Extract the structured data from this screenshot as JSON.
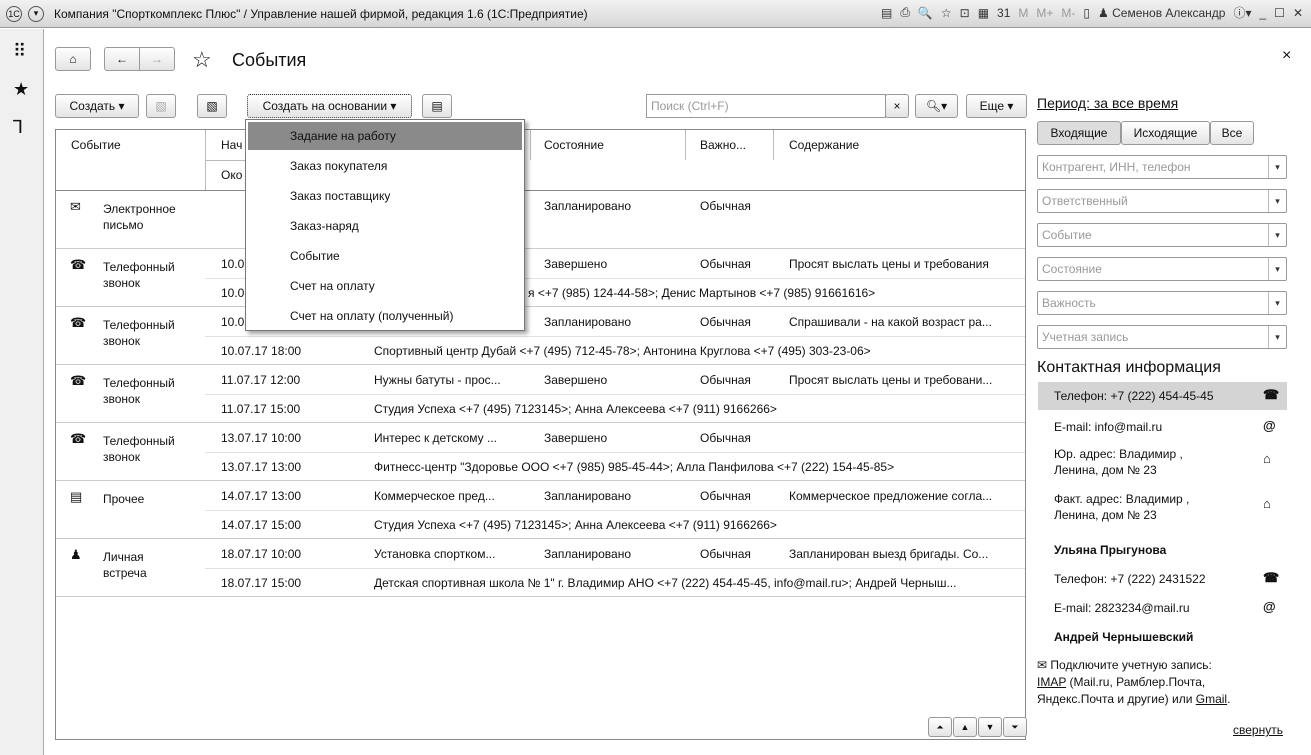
{
  "window": {
    "title": "Компания \"Спорткомплекс Плюс\" / Управление нашей фирмой, редакция 1.6  (1С:Предприятие)",
    "user": "Семенов Александр",
    "mem_buttons": [
      "M",
      "M+",
      "M-"
    ]
  },
  "page": {
    "title": "События",
    "close": "×"
  },
  "toolbar": {
    "create": "Создать",
    "create_based": "Создать на основании",
    "search_placeholder": "Поиск (Ctrl+F)",
    "search_clear": "×",
    "more": "Еще"
  },
  "menu": {
    "items": [
      "Задание на работу",
      "Заказ покупателя",
      "Заказ поставщику",
      "Заказ-наряд",
      "Событие",
      "Счет на оплату",
      "Счет на оплату (полученный)"
    ]
  },
  "table": {
    "headers": {
      "event": "Событие",
      "start": "Нач",
      "end": "Око",
      "state": "Состояние",
      "importance": "Важно...",
      "content": "Содержание"
    },
    "rows": [
      {
        "icon": "✉",
        "event": "Электронное\nписьмо",
        "start": "",
        "subject": "",
        "state": "Запланировано",
        "importance": "Обычная",
        "content": "",
        "end": "",
        "participants": ""
      },
      {
        "icon": "☎",
        "event": "Телефонный\nзвонок",
        "start": "10.0",
        "subject": "",
        "state": "Завершено",
        "importance": "Обычная",
        "content": "Просят выслать цены и требования",
        "end": "10.0",
        "participants": "я <+7 (985) 124-44-58>; Денис Мартынов <+7 (985) 91661616>"
      },
      {
        "icon": "☎",
        "event": "Телефонный\nзвонок",
        "start": "10.0",
        "subject": "",
        "state": "Запланировано",
        "importance": "Обычная",
        "content": "Спрашивали - на какой возраст ра...",
        "end": "10.07.17 18:00",
        "participants": "Спортивный центр Дубай <+7 (495) 712-45-78>; Антонина Круглова <+7 (495) 303-23-06>"
      },
      {
        "icon": "☎",
        "event": "Телефонный\nзвонок",
        "start": "11.07.17 12:00",
        "subject": "Нужны батуты - прос...",
        "state": "Завершено",
        "importance": "Обычная",
        "content": "Просят выслать цены и требовани...",
        "end": "11.07.17 15:00",
        "participants": "Студия Успеха <+7 (495) 7123145>; Анна Алексеева <+7 (911) 9166266>"
      },
      {
        "icon": "☎",
        "event": "Телефонный\nзвонок",
        "start": "13.07.17 10:00",
        "subject": "Интерес к детскому ...",
        "state": "Завершено",
        "importance": "Обычная",
        "content": "",
        "end": "13.07.17 13:00",
        "participants": "Фитнесс-центр \"Здоровье ООО <+7 (985) 985-45-44>; Алла Панфилова <+7 (222) 154-45-85>"
      },
      {
        "icon": "▤",
        "event": "Прочее",
        "start": "14.07.17 13:00",
        "subject": "Коммерческое пред...",
        "state": "Запланировано",
        "importance": "Обычная",
        "content": "Коммерческое предложение согла...",
        "end": "14.07.17 15:00",
        "participants": "Студия Успеха <+7 (495) 7123145>; Анна Алексеева <+7 (911) 9166266>"
      },
      {
        "icon": "♟",
        "event": "Личная\nвстреча",
        "start": "18.07.17 10:00",
        "subject": "Установка спортком...",
        "state": "Запланировано",
        "importance": "Обычная",
        "content": "Запланирован выезд бригады. Со...",
        "end": "18.07.17 15:00",
        "participants": "Детская спортивная школа  № 1\" г. Владимир АНО <+7 (222) 454-45-45, info@mail.ru>; Андрей Черныш..."
      }
    ]
  },
  "filters": {
    "period": "Период: за все время",
    "tabs": [
      "Входящие",
      "Исходящие",
      "Все"
    ],
    "fields": [
      "Контрагент, ИНН, телефон",
      "Ответственный",
      "Событие",
      "Состояние",
      "Важность",
      "Учетная запись"
    ]
  },
  "contacts": {
    "title": "Контактная информация",
    "items": [
      {
        "text": "Телефон: +7 (222) 454-45-45",
        "icon": "☎",
        "selected": true
      },
      {
        "text": "E-mail: info@mail.ru",
        "icon": "@"
      },
      {
        "text": "Юр. адрес: Владимир ,\nЛенина, дом № 23",
        "icon": "⌂"
      },
      {
        "text": "Факт. адрес: Владимир ,\nЛенина, дом № 23",
        "icon": "⌂"
      },
      {
        "text": "Ульяна Прыгунова",
        "bold": true
      },
      {
        "text": "Телефон: +7 (222) 2431522",
        "icon": "☎"
      },
      {
        "text": "E-mail: 2823234@mail.ru",
        "icon": "@"
      },
      {
        "text": "Андрей Чернышевский",
        "bold": true
      }
    ],
    "connect": "Подключите учетную запись:",
    "imap": "IMAP",
    "imap_rest": " (Mail.ru, Рамблер.Почта,",
    "line3": "Яндекс.Почта и другие) или ",
    "gmail": "Gmail",
    "dot": ".",
    "collapse": "свернуть"
  }
}
